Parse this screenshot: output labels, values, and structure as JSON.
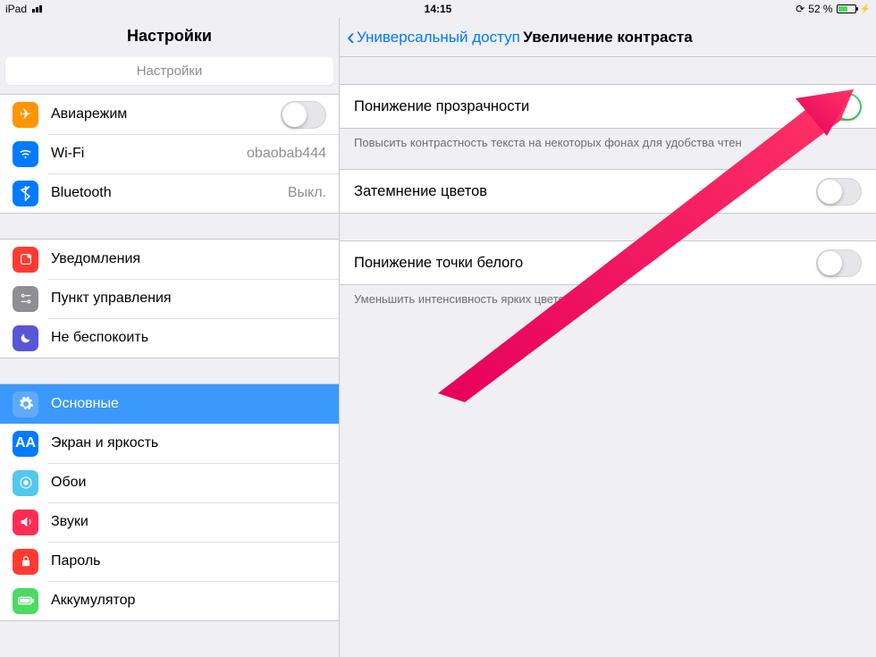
{
  "statusbar": {
    "device": "iPad",
    "time": "14:15",
    "battery_pct": "52 %"
  },
  "sidebar": {
    "title": "Настройки",
    "search_placeholder": "Настройки",
    "group1": {
      "airplane": "Авиарежим",
      "wifi": "Wi-Fi",
      "wifi_value": "obaobab444",
      "bluetooth": "Bluetooth",
      "bt_value": "Выкл."
    },
    "group2": {
      "notifications": "Уведомления",
      "control": "Пункт управления",
      "dnd": "Не беспокоить"
    },
    "group3": {
      "general": "Основные",
      "display": "Экран и яркость",
      "display_icon": "AA",
      "wallpaper": "Обои",
      "sounds": "Звуки",
      "passcode": "Пароль",
      "battery": "Аккумулятор"
    }
  },
  "detail": {
    "back_label": "Универсальный доступ",
    "title": "Увеличение контраста",
    "row1": "Понижение прозрачности",
    "row1_on": true,
    "footer1": "Повысить контрастность текста на некоторых фонах для удобства чтен",
    "row2": "Затемнение цветов",
    "row2_on": false,
    "row3": "Понижение точки белого",
    "row3_on": false,
    "footer3": "Уменьшить интенсивность ярких цветов."
  }
}
